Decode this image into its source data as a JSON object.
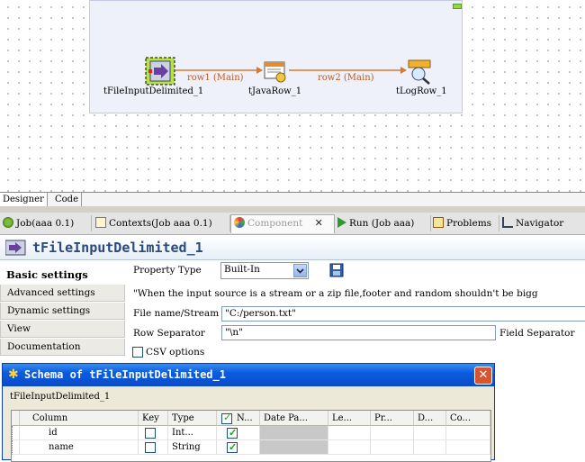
{
  "designer": {
    "components": [
      {
        "name": "tFileInputDelimited_1",
        "icon": "file-input-icon"
      },
      {
        "name": "tJavaRow_1",
        "icon": "java-row-icon"
      },
      {
        "name": "tLogRow_1",
        "icon": "log-row-icon"
      }
    ],
    "links": [
      "row1 (Main)",
      "row2 (Main)"
    ],
    "tabs": [
      "Designer",
      "Code"
    ]
  },
  "views": {
    "tabs": [
      {
        "label": "Job(aaa 0.1)",
        "icon": "job-icon"
      },
      {
        "label": "Contexts(Job aaa 0.1)",
        "icon": "contexts-icon"
      },
      {
        "label": "Component",
        "icon": "component-icon",
        "close": "✕"
      },
      {
        "label": "Run (Job aaa)",
        "icon": "run-icon"
      },
      {
        "label": "Problems",
        "icon": "problems-icon"
      },
      {
        "label": "Navigator",
        "icon": "navigator-icon"
      }
    ]
  },
  "component_view": {
    "title": "tFileInputDelimited_1",
    "nav": [
      "Basic settings",
      "Advanced settings",
      "Dynamic settings",
      "View",
      "Documentation"
    ],
    "property_type_label": "Property Type",
    "property_type_value": "Built-In",
    "note": "\"When the input source is a stream or a zip file,footer and random shouldn't be bigg",
    "file_name_label": "File name/Stream",
    "file_name_value": "\"C:/person.txt\"",
    "row_sep_label": "Row Separator",
    "row_sep_value": "\"\\n\"",
    "field_sep_label": "Field Separator",
    "csv_label": "CSV options"
  },
  "schema_dialog": {
    "title": "Schema of tFileInputDelimited_1",
    "subtitle": "tFileInputDelimited_1",
    "columns": [
      "Column",
      "Key",
      "Type",
      "N...",
      "Date Pa...",
      "Le...",
      "Pr...",
      "D...",
      "Co..."
    ],
    "rows": [
      {
        "column": "id",
        "type": "Int...",
        "key": false,
        "nullable": true
      },
      {
        "column": "name",
        "type": "String",
        "key": false,
        "nullable": true
      }
    ]
  }
}
